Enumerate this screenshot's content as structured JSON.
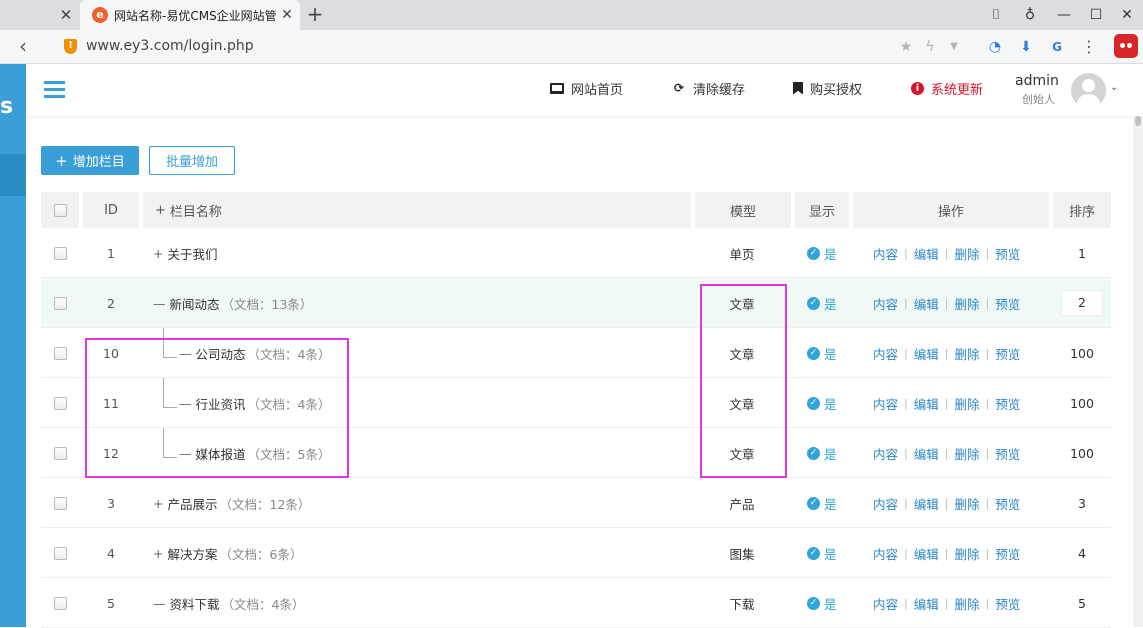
{
  "browser": {
    "tab_title": "网站名称-易优CMS企业网站管",
    "tab_favicon": "e",
    "url": "www.ey3.com/login.php"
  },
  "header": {
    "nav": [
      {
        "label": "网站首页",
        "icon": "monitor-icon"
      },
      {
        "label": "清除缓存",
        "icon": "refresh-icon"
      },
      {
        "label": "购买授权",
        "icon": "bookmark-icon"
      },
      {
        "label": "系统更新",
        "icon": "alert-icon",
        "color": "#d9142a"
      }
    ],
    "user_name": "admin",
    "user_role": "创始人"
  },
  "sidebar": {
    "logo_text": "s"
  },
  "toolbar": {
    "add_label": "增加栏目",
    "batch_label": "批量增加"
  },
  "table": {
    "columns": {
      "id": "ID",
      "name": "栏目名称",
      "model": "模型",
      "show": "显示",
      "ops": "操作",
      "sort": "排序"
    },
    "rows": [
      {
        "id": "1",
        "prefix": "+",
        "name": "关于我们",
        "count": "",
        "model": "单页",
        "show": "是",
        "sort": "1"
      },
      {
        "id": "2",
        "prefix": "—",
        "name": "新闻动态",
        "count": "（文档：13条）",
        "model": "文章",
        "show": "是",
        "sort": "2"
      },
      {
        "id": "10",
        "prefix": "—",
        "name": "公司动态",
        "count": "（文档：4条）",
        "model": "文章",
        "show": "是",
        "sort": "100"
      },
      {
        "id": "11",
        "prefix": "—",
        "name": "行业资讯",
        "count": "（文档：4条）",
        "model": "文章",
        "show": "是",
        "sort": "100"
      },
      {
        "id": "12",
        "prefix": "—",
        "name": "媒体报道",
        "count": "（文档：5条）",
        "model": "文章",
        "show": "是",
        "sort": "100"
      },
      {
        "id": "3",
        "prefix": "+",
        "name": "产品展示",
        "count": "（文档：12条）",
        "model": "产品",
        "show": "是",
        "sort": "3"
      },
      {
        "id": "4",
        "prefix": "+",
        "name": "解决方案",
        "count": "（文档：6条）",
        "model": "图集",
        "show": "是",
        "sort": "4"
      },
      {
        "id": "5",
        "prefix": "—",
        "name": "资料下载",
        "count": "（文档：4条）",
        "model": "下载",
        "show": "是",
        "sort": "5"
      }
    ],
    "ops": [
      "内容",
      "编辑",
      "删除",
      "预览"
    ]
  },
  "colors": {
    "accent": "#3a9fd9",
    "annotation": "#e036e0",
    "danger": "#d9142a"
  }
}
